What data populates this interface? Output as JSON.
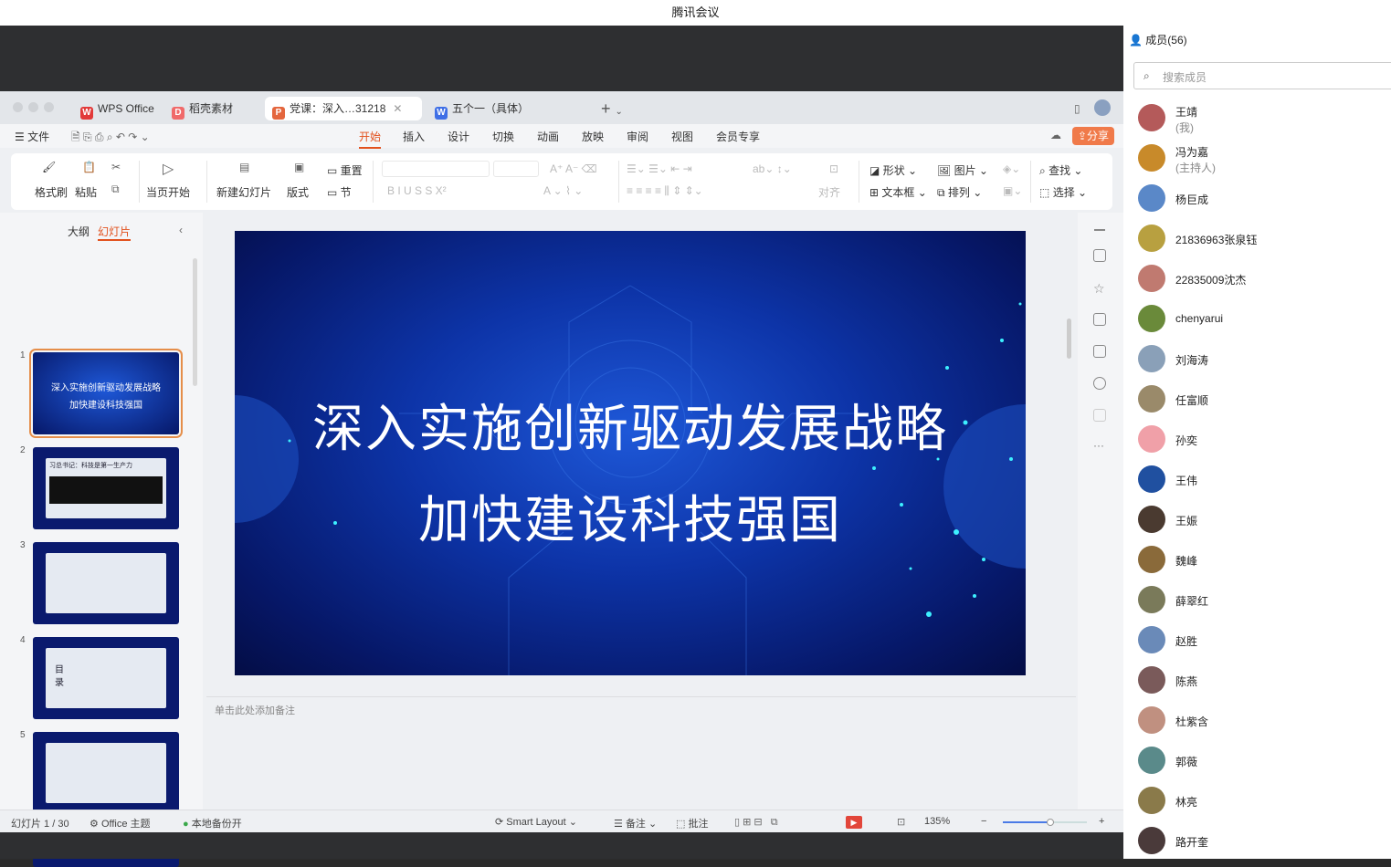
{
  "window_title": "腾讯会议",
  "wps": {
    "tabs": [
      {
        "label": "WPS Office",
        "icon": "W",
        "color": "#e23a3a"
      },
      {
        "label": "稻壳素材",
        "icon": "D",
        "color": "#f06a6a"
      },
      {
        "label": "党课：深入…31218",
        "icon": "P",
        "color": "#e4663d"
      },
      {
        "label": "五个一（具体）",
        "icon": "W",
        "color": "#3f6fe6"
      }
    ],
    "file_menu": "文件",
    "menu": [
      "开始",
      "插入",
      "设计",
      "切换",
      "动画",
      "放映",
      "审阅",
      "视图",
      "会员专享"
    ],
    "share": "分享",
    "ribbon": {
      "format_painter": "格式刷",
      "paste": "粘贴",
      "play_current": "当页开始",
      "new_slide": "新建幻灯片",
      "layout": "版式",
      "reset": "重置",
      "section": "节",
      "align": "对齐",
      "shape": "形状",
      "image": "图片",
      "textbox": "文本框",
      "arrange": "排列",
      "find": "查找",
      "select": "选择"
    },
    "pane_tabs": {
      "outline": "大纲",
      "slides": "幻灯片"
    },
    "thumb_texts": {
      "t1_line1": "深入实施创新驱动发展战略",
      "t1_line2": "加快建设科技强国",
      "t2_title": "习总书记：科技是第一生产力",
      "t4_title": "目 录"
    },
    "slide": {
      "line1": "深入实施创新驱动发展战略",
      "line2": "加快建设科技强国"
    },
    "notes_placeholder": "单击此处添加备注",
    "status": {
      "slide_count": "幻灯片 1 / 30",
      "theme": "Office 主题",
      "backup": "本地备份开",
      "smart_layout": "Smart Layout",
      "notes": "备注",
      "comments": "批注",
      "zoom": "135%"
    }
  },
  "members": {
    "header": "成员(56)",
    "search_placeholder": "搜索成员",
    "list": [
      {
        "name": "王靖",
        "sub": "(我)",
        "color": "#b45a5a"
      },
      {
        "name": "冯为嘉",
        "sub": "(主持人)",
        "color": "#c88a2a"
      },
      {
        "name": "杨巨成",
        "sub": "",
        "color": "#5a88c8"
      },
      {
        "name": "21836963张泉钰",
        "sub": "",
        "color": "#b8a040"
      },
      {
        "name": "22835009沈杰",
        "sub": "",
        "color": "#c07a70"
      },
      {
        "name": "chenyarui",
        "sub": "",
        "color": "#6a8a3a"
      },
      {
        "name": "刘海涛",
        "sub": "",
        "color": "#8aa0b8"
      },
      {
        "name": "任富顺",
        "sub": "",
        "color": "#9a8a6a"
      },
      {
        "name": "孙奕",
        "sub": "",
        "color": "#f0a0a8"
      },
      {
        "name": "王伟",
        "sub": "",
        "color": "#2050a0"
      },
      {
        "name": "王娠",
        "sub": "",
        "color": "#4a3a30"
      },
      {
        "name": "魏峰",
        "sub": "",
        "color": "#8a6a3a"
      },
      {
        "name": "薛翠红",
        "sub": "",
        "color": "#7a7a5a"
      },
      {
        "name": "赵胜",
        "sub": "",
        "color": "#6a8ab8"
      },
      {
        "name": "陈燕",
        "sub": "",
        "color": "#7a5a5a"
      },
      {
        "name": "杜紫含",
        "sub": "",
        "color": "#c09080"
      },
      {
        "name": "郭薇",
        "sub": "",
        "color": "#5a8a8a"
      },
      {
        "name": "林亮",
        "sub": "",
        "color": "#8a7a4a"
      },
      {
        "name": "路开奎",
        "sub": "",
        "color": "#4a3a3a"
      }
    ]
  }
}
